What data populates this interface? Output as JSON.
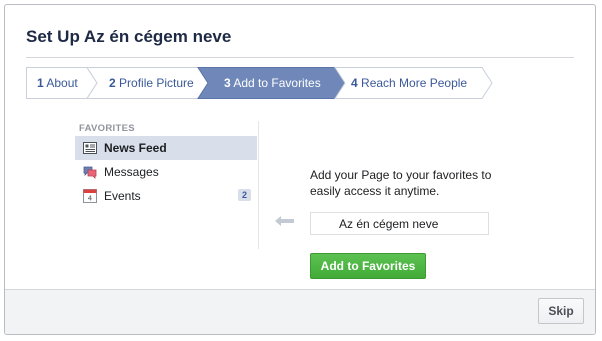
{
  "dialog": {
    "title": "Set Up Az én cégem neve"
  },
  "steps": [
    {
      "num": "1",
      "label": "About",
      "active": false
    },
    {
      "num": "2",
      "label": "Profile Picture",
      "active": false
    },
    {
      "num": "3",
      "label": "Add to Favorites",
      "active": true
    },
    {
      "num": "4",
      "label": "Reach More People",
      "active": false
    }
  ],
  "favorites": {
    "heading": "FAVORITES",
    "items": [
      {
        "label": "News Feed",
        "icon": "news-feed-icon",
        "selected": true
      },
      {
        "label": "Messages",
        "icon": "messages-icon",
        "selected": false
      },
      {
        "label": "Events",
        "icon": "calendar-icon",
        "selected": false,
        "count": "2"
      }
    ]
  },
  "content": {
    "description": "Add your Page to your favorites to easily access it anytime.",
    "page_name": "Az én cégem neve",
    "add_button": "Add to Favorites"
  },
  "footer": {
    "skip_button": "Skip"
  },
  "colors": {
    "brand_blue": "#3b5998",
    "active_step": "#6f88b9",
    "green_button": "#4bb540",
    "selected_row": "#d8dfea"
  }
}
